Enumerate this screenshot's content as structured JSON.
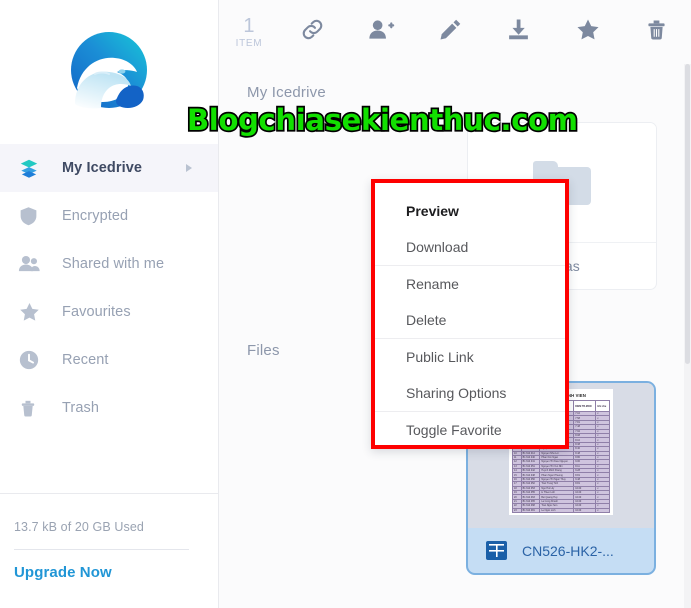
{
  "app": {
    "name": "Icedrive"
  },
  "sidebar": {
    "logo_icon": "icedrive-polar-bear-logo",
    "items": [
      {
        "label": "My Icedrive",
        "icon": "layers-icon",
        "active": true,
        "caret": true
      },
      {
        "label": "Encrypted",
        "icon": "shield-icon",
        "active": false,
        "caret": false
      },
      {
        "label": "Shared with me",
        "icon": "people-icon",
        "active": false,
        "caret": false
      },
      {
        "label": "Favourites",
        "icon": "star-icon",
        "active": false,
        "caret": false
      },
      {
        "label": "Recent",
        "icon": "clock-icon",
        "active": false,
        "caret": false
      },
      {
        "label": "Trash",
        "icon": "trash-icon",
        "active": false,
        "caret": false
      }
    ],
    "storage_text": "13.7 kB of 20 GB Used",
    "upgrade_label": "Upgrade Now"
  },
  "toolbar": {
    "count_number": "1",
    "count_label": "ITEM",
    "actions": [
      {
        "name": "link-icon",
        "title": "Public Link"
      },
      {
        "name": "add-user-icon",
        "title": "Share"
      },
      {
        "name": "pencil-icon",
        "title": "Rename"
      },
      {
        "name": "download-icon",
        "title": "Download"
      },
      {
        "name": "star-icon",
        "title": "Favourite"
      },
      {
        "name": "trash-icon",
        "title": "Delete"
      }
    ]
  },
  "main": {
    "breadcrumb": "My Icedrive",
    "folders_section": {
      "items": [
        {
          "name": "Blogchias",
          "icon": "folder-icon"
        }
      ]
    },
    "files_section": {
      "title": "Files",
      "items": [
        {
          "name": "CN526-HK2-...",
          "icon": "spreadsheet-icon",
          "selected": true,
          "thumbnail_title": "DANH SACH SINH VIEN",
          "thumbnail_headers": [
            "STT",
            "MSSV",
            "Ho va ten",
            "DIEM\nTB-MON",
            "Ghi chu"
          ],
          "thumbnail_rows": [
            [
              "1",
              "CB 48 16 71",
              "Tra A Duong",
              "7.10",
              "x"
            ],
            [
              "2",
              "B1 610 174",
              "Li Thi Dao Anh",
              "7.58",
              "x"
            ],
            [
              "3",
              "B1 614 001",
              "Hoang Anh Duc",
              "7.81",
              "x"
            ],
            [
              "4",
              "B1 614 008",
              "Pham Thi Hong Nhu",
              "7.48",
              "x"
            ],
            [
              "5",
              "B1 614 011",
              "Vu Thi Hong Nguyen",
              "7.92",
              "x"
            ],
            [
              "6",
              "B1 614 015",
              "Bi Tieu Giang Huy",
              "8.08",
              "x"
            ],
            [
              "7",
              "B1 614 017",
              "Vu Thanh Khuong",
              "8.10",
              "x"
            ],
            [
              "8",
              "B1 614 021",
              "Li Thi Kim Khoa",
              "8.38",
              "x"
            ],
            [
              "9",
              "B1 614 031",
              "Nguyen Thi Nhat A",
              "8.40",
              "x"
            ],
            [
              "10",
              "B1 614 014",
              "Nguyen Nhu Loi",
              "8.48",
              "x"
            ],
            [
              "11",
              "B1 614 040",
              "Phan Kim Ngan",
              "8.80",
              "x"
            ],
            [
              "12",
              "B1 614 041",
              "Nguyen Thi Kieu Nguyen",
              "9.00",
              "x"
            ],
            [
              "13",
              "B1 614 051",
              "Nguyen Thi Yen Nhi",
              "8.11",
              "x"
            ],
            [
              "14",
              "B1 614 042",
              "Huynh Minh Khang",
              "9.28",
              "x"
            ],
            [
              "15",
              "B1 614 048",
              "Pham Ngoc Phuong",
              "8.81",
              "x"
            ],
            [
              "16",
              "B1 614 050",
              "Nguyen Thi Ngoc Thuy",
              "9.48",
              "x"
            ],
            [
              "17",
              "B1 614 052",
              "Tran Trung Tinh",
              "8.81",
              "x"
            ],
            [
              "18",
              "B1 614 053",
              "Ngo Hoi Lily",
              "10.00",
              "x"
            ],
            [
              "19",
              "B1 614 055",
              "Li Thien Linh",
              "10.00",
              "x"
            ],
            [
              "20",
              "B1 614 063",
              "Bui Quang Huy",
              "10.00",
              "x"
            ],
            [
              "21",
              "B1 614 065",
              "La Cong Khanh",
              "10.00",
              "x"
            ],
            [
              "22",
              "B1 614 068",
              "Tran Ngoc Son",
              "10.00",
              "x"
            ],
            [
              "23",
              "B1 614 081",
              "Le Ngoc Linh",
              "10.00",
              "x"
            ]
          ]
        }
      ]
    }
  },
  "context_menu": {
    "highlight_color": "#fe0000",
    "groups": [
      {
        "items": [
          {
            "label": "Preview",
            "strong": true
          },
          {
            "label": "Download",
            "strong": false
          }
        ]
      },
      {
        "items": [
          {
            "label": "Rename",
            "strong": false
          },
          {
            "label": "Delete",
            "strong": false
          }
        ]
      },
      {
        "items": [
          {
            "label": "Public Link",
            "strong": false
          },
          {
            "label": "Sharing Options",
            "strong": false
          }
        ]
      },
      {
        "items": [
          {
            "label": "Toggle Favorite",
            "strong": false
          }
        ]
      }
    ]
  },
  "watermark": {
    "text": "Blogchiasekienthuc.com",
    "color": "#12e000",
    "outline": "#000000"
  }
}
